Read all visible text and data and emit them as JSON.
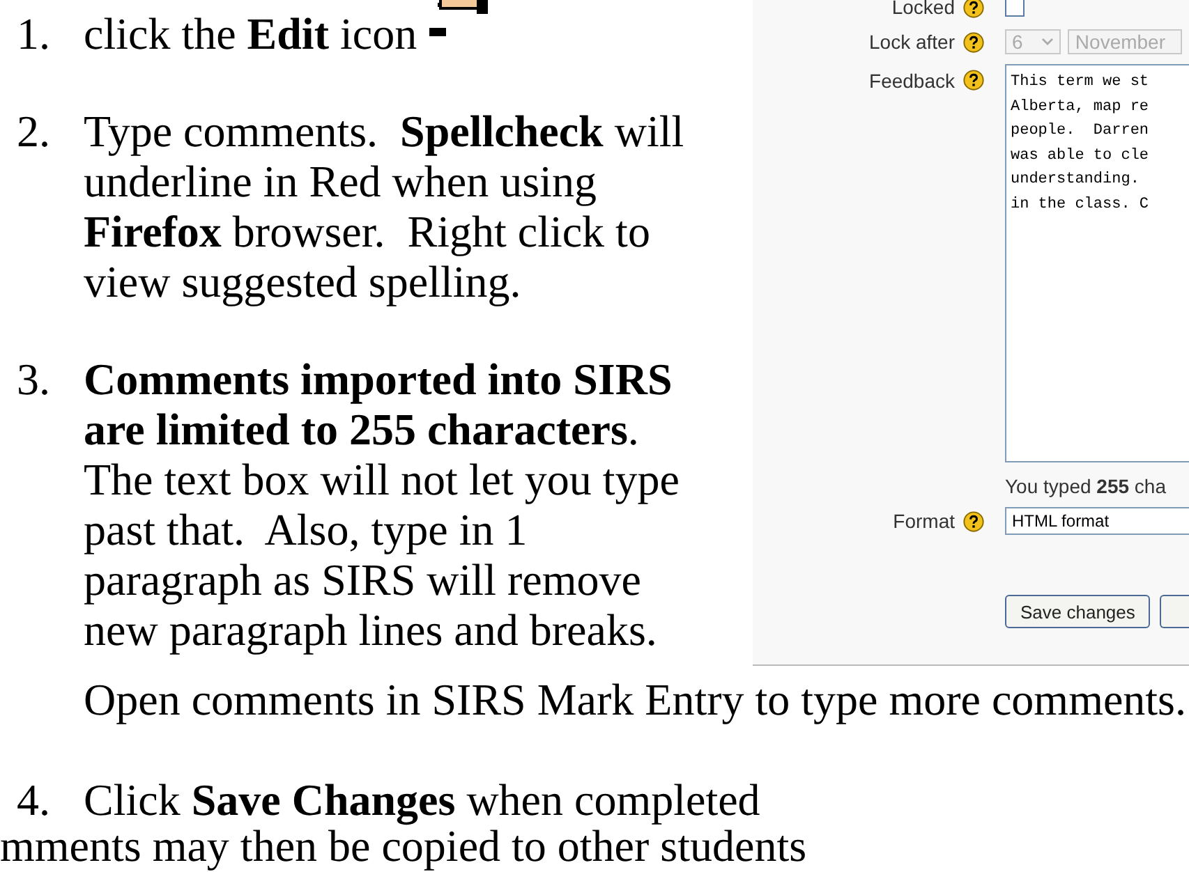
{
  "steps": [
    {
      "number": "1.",
      "text": "click the **Edit** icon",
      "icon": true
    },
    {
      "number": "2.",
      "text": "Type comments.  **Spellcheck** will underline in Red when using **Firefox** browser.  Right click to view suggested spelling."
    },
    {
      "number": "3.",
      "text": "**Comments imported into SIRS are limited to 255 characters**. The text box will not let you type past that.  Also, type in 1 paragraph as SIRS will remove new paragraph lines and breaks.",
      "note": "Open comments in SIRS Mark Entry to type more comments."
    },
    {
      "number": "4.",
      "text": "Click **Save Changes** when completed",
      "note": "mments may then be copied to other students"
    }
  ],
  "form": {
    "locked": {
      "label": "Locked",
      "checked": false
    },
    "lock_after": {
      "label": "Lock after",
      "day": "6",
      "month": "November",
      "disabled": true
    },
    "feedback": {
      "label": "Feedback",
      "lines": [
        "This term we st",
        "Alberta, map re",
        "people.  Darren",
        "was able to cle",
        "understanding.",
        "in the class. C"
      ],
      "counter": "You typed **255** cha"
    },
    "format": {
      "label": "Format",
      "value": "HTML format"
    },
    "buttons": [
      "Save changes"
    ]
  }
}
